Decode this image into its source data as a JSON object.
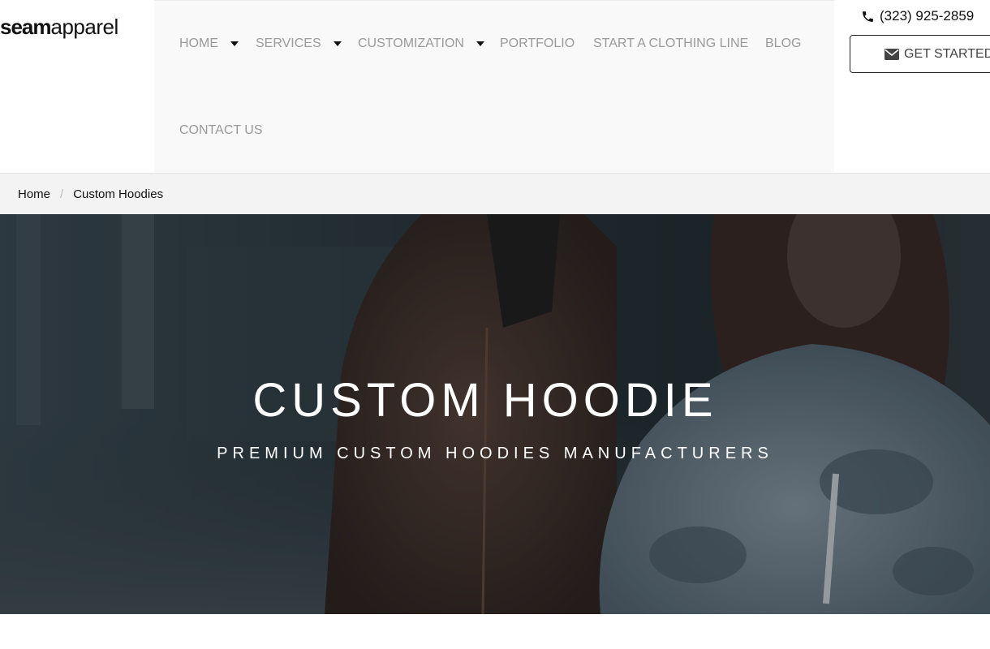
{
  "logo": {
    "bold": "seam",
    "light": "apparel"
  },
  "nav": {
    "items": [
      {
        "label": "HOME",
        "dropdown": true
      },
      {
        "label": "SERVICES",
        "dropdown": true
      },
      {
        "label": "CUSTOMIZATION",
        "dropdown": true
      },
      {
        "label": "PORTFOLIO",
        "dropdown": false
      },
      {
        "label": "START A CLOTHING LINE",
        "dropdown": false
      },
      {
        "label": "BLOG",
        "dropdown": false
      },
      {
        "label": "CONTACT US",
        "dropdown": false
      }
    ]
  },
  "contact": {
    "phone": "(323) 925-2859",
    "phone_icon": "phone-icon",
    "cta_label": "GET STARTED",
    "cta_icon": "envelope-icon"
  },
  "breadcrumb": {
    "home": "Home",
    "current": "Custom Hoodies"
  },
  "hero": {
    "title": "CUSTOM HOODIE",
    "subtitle": "PREMIUM CUSTOM HOODIES MANUFACTURERS"
  },
  "colors": {
    "nav_text": "#9a9a9a",
    "nav_bg": "#f9f9f9",
    "breadcrumb_bg": "#f3f3f3",
    "hero_overlay": "#2a3035"
  }
}
